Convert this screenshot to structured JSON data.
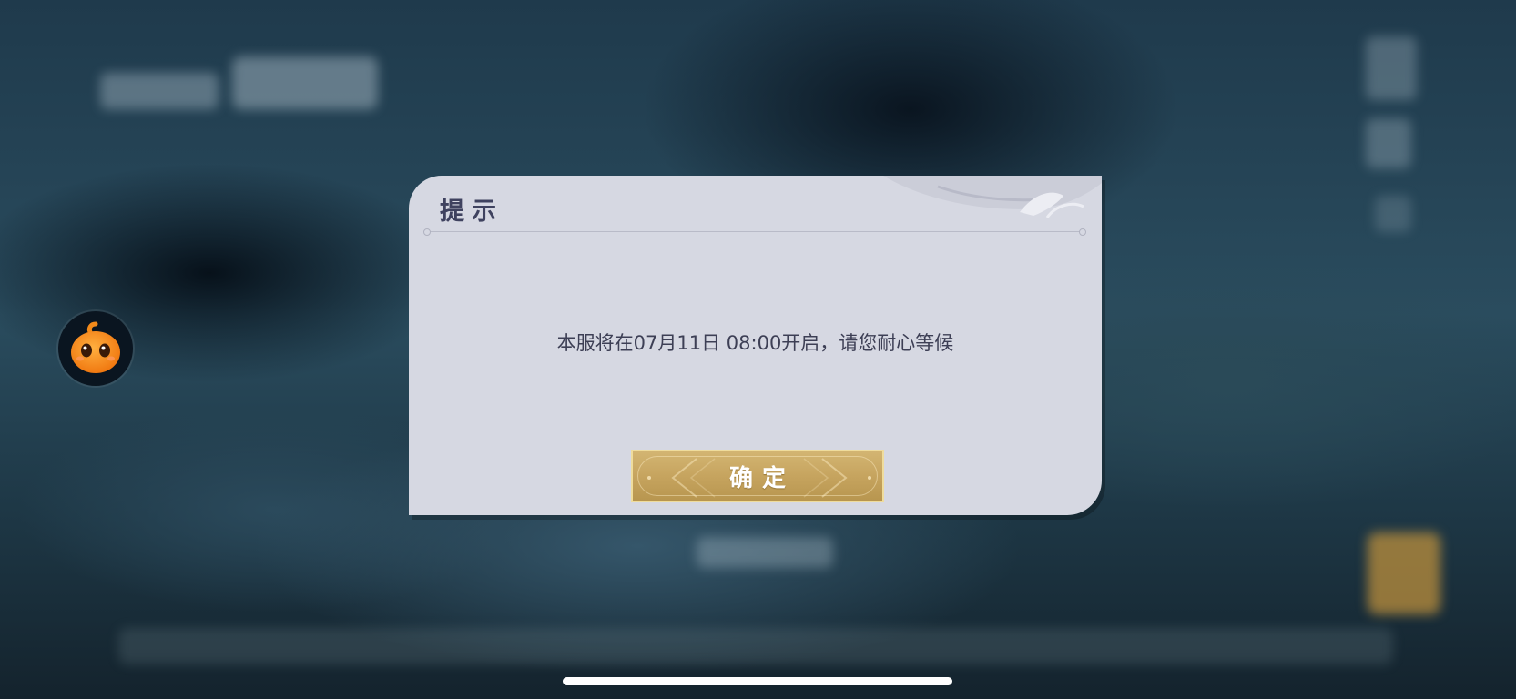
{
  "dialog": {
    "title": "提示",
    "message": "本服将在07月11日 08:00开启，请您耐心等候",
    "confirm_label": "确定"
  },
  "colors": {
    "dialog_bg": "#d6d8e2",
    "title_text": "#3f425f",
    "button_gold": "#c6a45f",
    "assistant_orange": "#f08a1c"
  },
  "icons": {
    "assistant": "orange-mascot-icon"
  }
}
